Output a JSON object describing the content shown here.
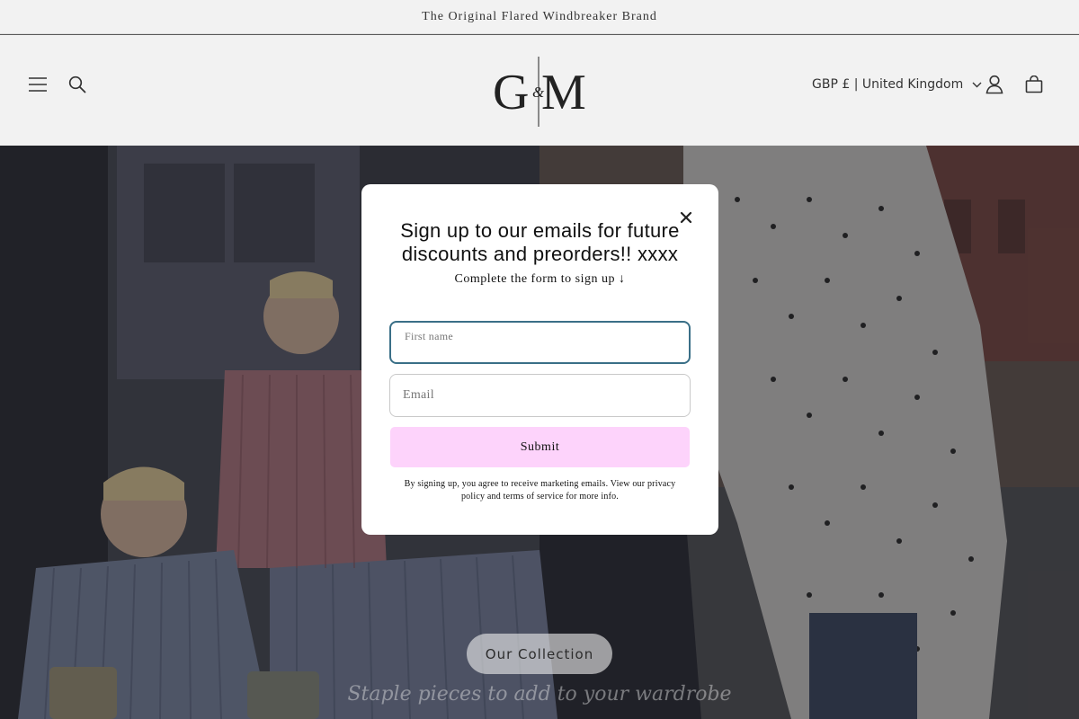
{
  "announcement": {
    "text": "The Original Flared Windbreaker Brand"
  },
  "header": {
    "menu_icon": "hamburger-menu-icon",
    "search_icon": "search-icon",
    "logo_text": "G&M",
    "country_selector": "GBP £ | United Kingdom",
    "account_icon": "user-icon",
    "cart_icon": "cart-icon"
  },
  "hero": {
    "button_label": "Our Collection",
    "subtitle": "Staple pieces to add to your wardrobe"
  },
  "popup": {
    "title": "Sign up to our emails for future discounts and preorders!! xxxx",
    "subtitle": "Complete the form to sign up ↓",
    "first_name_label": "First name",
    "first_name_value": "",
    "email_placeholder": "Email",
    "submit_label": "Submit",
    "legal": "By signing up, you agree to receive marketing emails. View our privacy policy and terms of service for more info.",
    "close_icon": "close-icon"
  },
  "colors": {
    "header_bg": "#f2f2f2",
    "submit_bg": "#fdd3fb",
    "focus_border": "#3a6f87"
  }
}
